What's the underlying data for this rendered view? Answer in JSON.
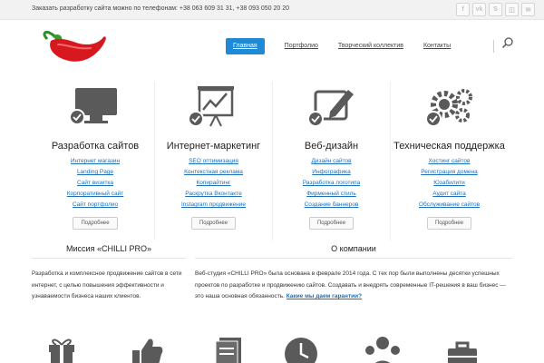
{
  "topbar": {
    "contact_text": "Заказать разработку сайта можно по телефонам: +38 063 609 31 31, +38 093 050 20 20",
    "socials": [
      {
        "icon": "facebook-icon",
        "glyph": "f"
      },
      {
        "icon": "vk-icon",
        "glyph": "vk"
      },
      {
        "icon": "skype-icon",
        "glyph": "S"
      },
      {
        "icon": "instagram-icon",
        "glyph": "◫"
      },
      {
        "icon": "email-icon",
        "glyph": "✉"
      }
    ]
  },
  "nav": {
    "items": [
      {
        "label": "Главная",
        "active": true
      },
      {
        "label": "Портфолио",
        "active": false
      },
      {
        "label": "Творческий коллектив",
        "active": false
      },
      {
        "label": "Контакты",
        "active": false
      }
    ]
  },
  "services": [
    {
      "icon": "monitor-icon",
      "title": "Разработка сайтов",
      "links": [
        "Интернет магазин",
        "Landing Page",
        "Сайт визитка",
        "Корпоративный сайт",
        "Сайт портфолио"
      ],
      "more_label": "Подробнее"
    },
    {
      "icon": "chart-presentation-icon",
      "title": "Интернет-маркетинг",
      "links": [
        "SEO оптимизация",
        "Контекстная реклама",
        "Копирайтинг",
        "Раскрутка Вконтакте",
        "Instagram продвижение"
      ],
      "more_label": "Подробнее"
    },
    {
      "icon": "edit-pencil-icon",
      "title": "Веб-дизайн",
      "links": [
        "Дизайн сайтов",
        "Инфографика",
        "Разработка логотипа",
        "Фирменный стиль",
        "Создание баннеров"
      ],
      "more_label": "Подробнее"
    },
    {
      "icon": "gears-icon",
      "title": "Техническая поддержка",
      "links": [
        "Хостинг сайтов",
        "Регистрация домена",
        "Юзабилити",
        "Аудит сайта",
        "Обслуживание сайтов"
      ],
      "more_label": "Подробнее"
    }
  ],
  "mission": {
    "title": "Миссия «CHILLI PRO»",
    "text": "Разработка и комплексное продвижение сайтов в сети интернет, с целью повышения эффективности и узнаваемости бизнеса наших клиентов."
  },
  "about": {
    "title": "О компании",
    "text": "Веб-студия «CHILLI PRO» была основана в феврале 2014 года. С тех пор были выполнены десятки успешных проектов по разработке и продвижению сайтов. Создавать и внедрять современные IT-решения в ваш бизнес — это наша основная обязанность.",
    "link": "Какие мы даем гарантии?"
  },
  "bottom_icons": [
    "gift-icon",
    "thumbs-up-icon",
    "documents-icon",
    "clock-icon",
    "team-icon",
    "briefcase-icon"
  ],
  "colors": {
    "accent": "#1e8ad6",
    "link": "#1e6fb8",
    "icon_gray": "#5a5a5a",
    "chili_red": "#d7191f"
  }
}
